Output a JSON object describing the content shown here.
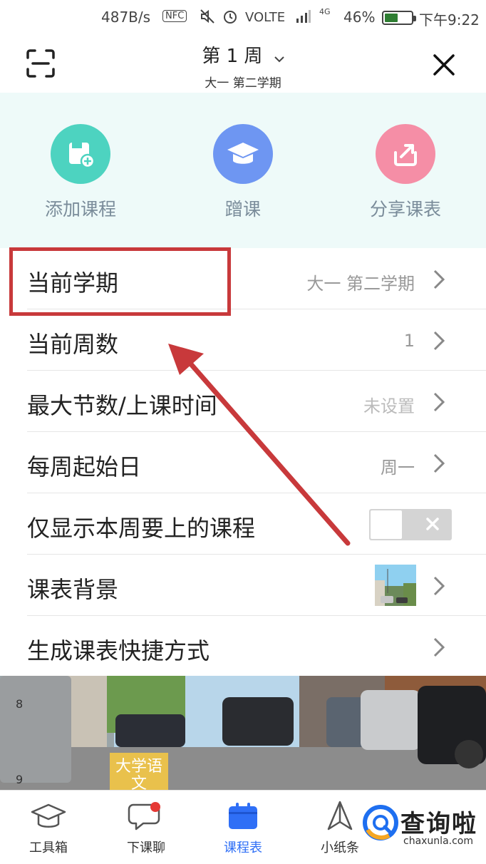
{
  "status_bar": {
    "speed": "487B/s",
    "nfc": "NFC",
    "network": "VOLTE",
    "signal": "4G",
    "battery": "46%",
    "time": "下午9:22"
  },
  "header": {
    "week_title": "第 1 周",
    "semester": "大一  第二学期"
  },
  "actions": [
    {
      "label": "添加课程",
      "color": "#4dd3c0",
      "icon": "add-book-icon"
    },
    {
      "label": "蹭课",
      "color": "#6e96f2",
      "icon": "graduation-cap-icon"
    },
    {
      "label": "分享课表",
      "color": "#f58ea6",
      "icon": "share-icon"
    }
  ],
  "settings": {
    "current_semester": {
      "label": "当前学期",
      "value": "大一  第二学期"
    },
    "current_week": {
      "label": "当前周数",
      "value": "1"
    },
    "max_sections": {
      "label": "最大节数/上课时间",
      "value": "未设置"
    },
    "week_start": {
      "label": "每周起始日",
      "value": "周一"
    },
    "only_this_week": {
      "label": "仅显示本周要上的课程",
      "enabled": false
    },
    "background": {
      "label": "课表背景"
    },
    "shortcut": {
      "label": "生成课表快捷方式"
    }
  },
  "timetable_preview": {
    "course": "大学语文",
    "week_numbers": [
      "8",
      "9"
    ]
  },
  "tab_bar": {
    "items": [
      {
        "label": "工具箱",
        "icon": "graduation-cap-icon",
        "active": false
      },
      {
        "label": "下课聊",
        "icon": "chat-bubble-icon",
        "active": false,
        "badge": true
      },
      {
        "label": "课程表",
        "icon": "timetable-icon",
        "active": true
      },
      {
        "label": "小纸条",
        "icon": "paper-plane-icon",
        "active": false
      }
    ]
  },
  "watermark": {
    "text": "查询啦",
    "url": "chaxunla.com"
  },
  "colors": {
    "accent": "#2f6ff6",
    "highlight": "#c8393b",
    "panel_bg": "#eefaf9"
  }
}
